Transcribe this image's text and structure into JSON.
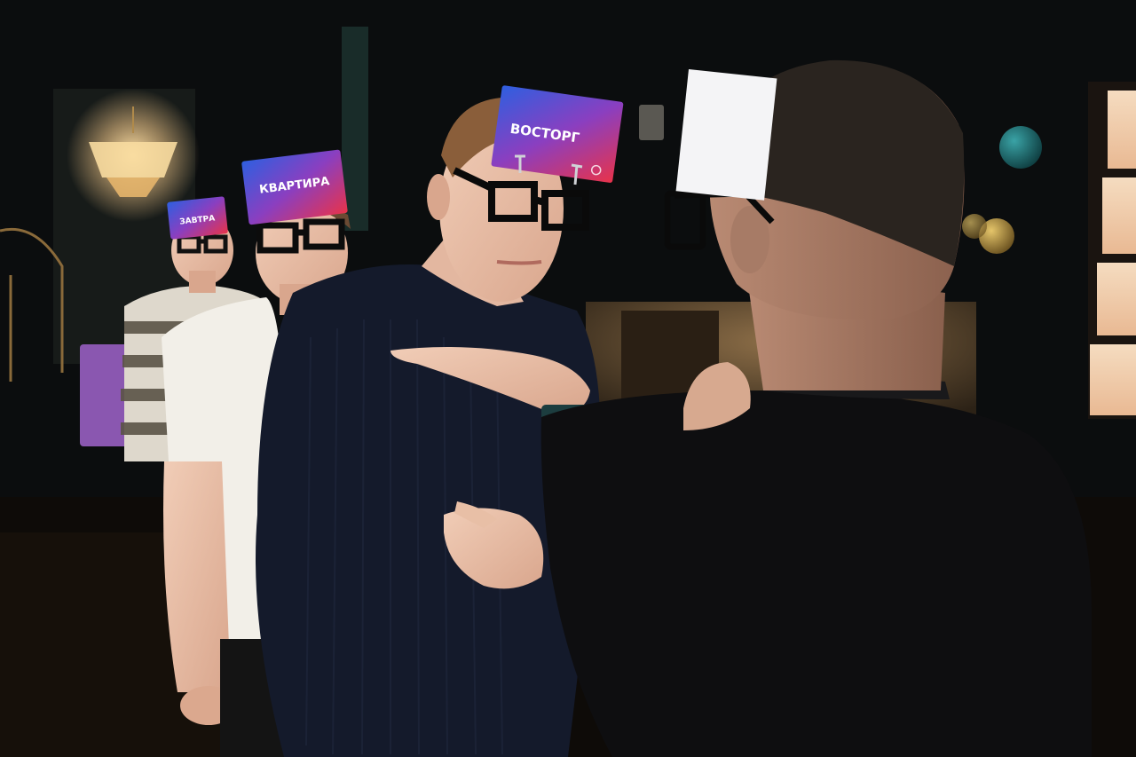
{
  "photo": {
    "cards": {
      "front": "ВОСТОРГ",
      "middle": "КВАРТИРА",
      "back": "ЗАВТРА"
    }
  },
  "colors": {
    "background": "#0a0b0d",
    "card_red": "#e0334a",
    "card_blue": "#3a4fc9",
    "lamp_glow": "#f4c98a",
    "panel_glow": "#f2d2b4",
    "balloon_teal": "#1e6c70",
    "box_purple": "#8a57b0"
  }
}
